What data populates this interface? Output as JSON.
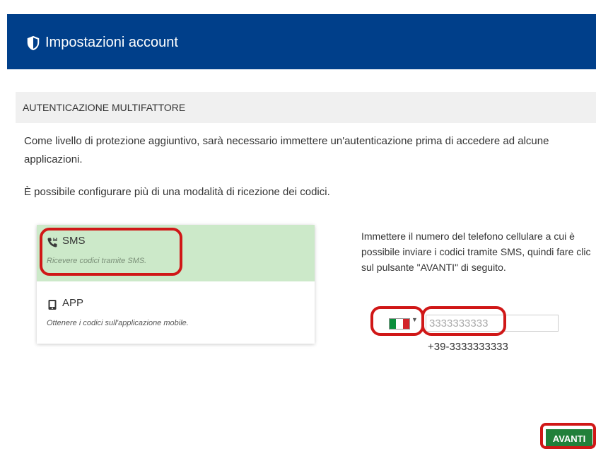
{
  "header": {
    "title": "Impostazioni account",
    "icon": "shield-icon",
    "color": "#003f8a"
  },
  "section": {
    "title": "AUTENTICAZIONE MULTIFATTORE"
  },
  "intro": "Come livello di protezione aggiuntivo, sarà necessario immettere un'autenticazione prima di accedere ad alcune applicazioni.",
  "hint": "È possibile configurare più di una modalità di ricezione dei codici.",
  "methods": [
    {
      "icon": "phone-icon",
      "title": "SMS",
      "description": "Ricevere codici tramite SMS.",
      "selected": true
    },
    {
      "icon": "mobile-app-icon",
      "title": "APP",
      "description": "Ottenere i codici sull'applicazione mobile.",
      "selected": false
    }
  ],
  "instructions": "Immettere il numero del telefono cellulare a cui è possibile inviare i codici tramite SMS, quindi fare clic sul pulsante \"AVANTI\" di seguito.",
  "phone": {
    "country_flag": "italy-flag-icon",
    "value": "3333333333",
    "preview": "+39-3333333333"
  },
  "button": {
    "label": "AVANTI",
    "color": "#21803a"
  },
  "highlight_color": "#d01717"
}
